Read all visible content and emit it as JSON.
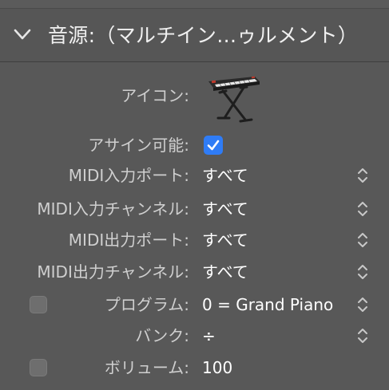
{
  "header": {
    "title": "音源:（マルチイン…ゥルメント）",
    "chevron_icon": "chevron-down-icon"
  },
  "rows": {
    "icon": {
      "label": "アイコン:",
      "value_icon": "keyboard-stand-icon"
    },
    "assignable": {
      "label": "アサイン可能:",
      "checked": true
    },
    "midi_in_port": {
      "label": "MIDI入力ポート:",
      "value": "すべて"
    },
    "midi_in_channel": {
      "label": "MIDI入力チャンネル:",
      "value": "すべて"
    },
    "midi_out_port": {
      "label": "MIDI出力ポート:",
      "value": "すべて"
    },
    "midi_out_channel": {
      "label": "MIDI出力チャンネル:",
      "value": "すべて"
    },
    "program": {
      "label": "プログラム:",
      "value": "0 = Grand Piano",
      "enabled": false
    },
    "bank": {
      "label": "バンク:",
      "value": "÷"
    },
    "volume": {
      "label": "ボリューム:",
      "value": "100",
      "enabled": false
    }
  },
  "colors": {
    "background": "#585858",
    "header_background": "#565656",
    "label_text": "#cfcfcf",
    "value_text": "#ffffff",
    "checkbox_accent": "#2f7cf6"
  }
}
